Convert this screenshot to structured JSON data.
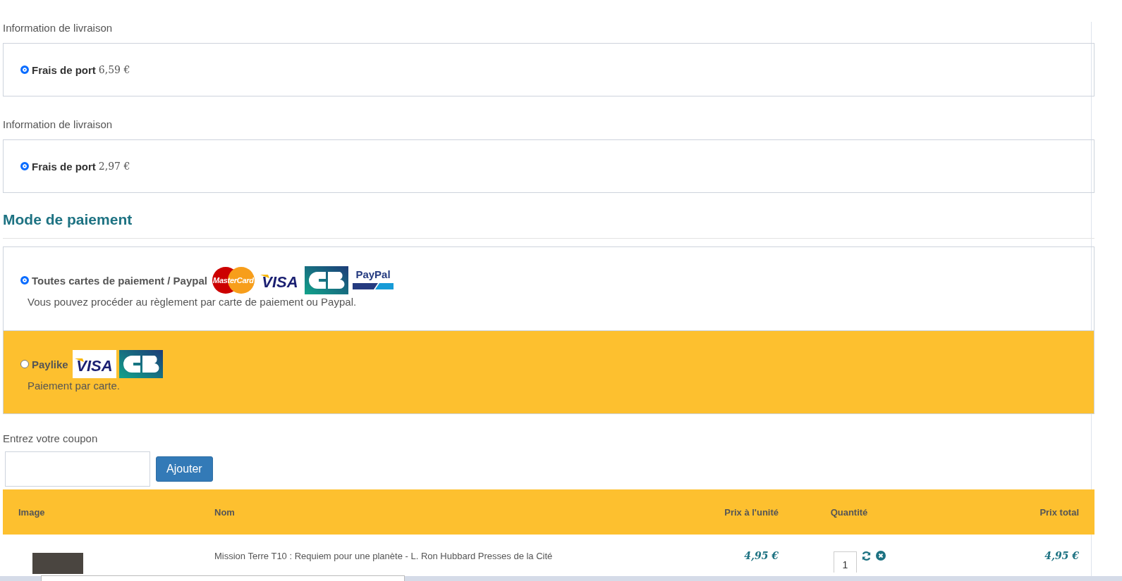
{
  "shipping": [
    {
      "heading": "Information de livraison",
      "label": "Frais de port",
      "price": "6,59 €",
      "selected": true
    },
    {
      "heading": "Information de livraison",
      "label": "Frais de port",
      "price": "2,97 €",
      "selected": true
    }
  ],
  "payment": {
    "title": "Mode de paiement",
    "methods": [
      {
        "label": "Toutes cartes de paiement / Paypal",
        "description": "Vous pouvez procéder au règlement par carte de paiement ou Paypal.",
        "selected": true,
        "logos": [
          {
            "kind": "mastercard",
            "text": "MasterCard"
          },
          {
            "kind": "visa",
            "text": "VISA"
          },
          {
            "kind": "cb"
          },
          {
            "kind": "paypal",
            "text": "PayPal"
          }
        ]
      },
      {
        "label": "Paylike",
        "description": "Paiement par carte.",
        "selected": false,
        "logos": [
          {
            "kind": "visa",
            "text": "VISA"
          },
          {
            "kind": "cb"
          }
        ]
      }
    ]
  },
  "coupon": {
    "label": "Entrez votre coupon",
    "button": "Ajouter"
  },
  "table": {
    "columns": [
      "Image",
      "Nom",
      "Prix à l'unité",
      "Quantité",
      "Prix total"
    ],
    "rows": [
      {
        "name": "Mission Terre T10 : Requiem pour une planète - L. Ron Hubbard Presses de la Cité",
        "unit_price": "4,95 €",
        "quantity": "1",
        "total": "4,95 €"
      }
    ]
  }
}
